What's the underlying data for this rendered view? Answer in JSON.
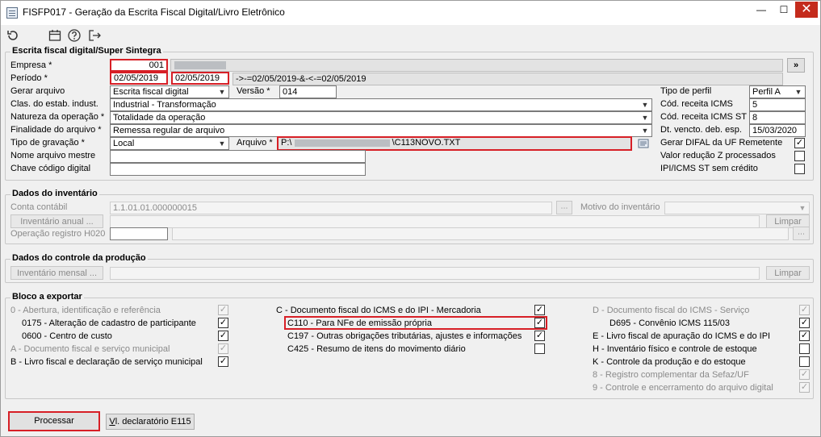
{
  "window": {
    "title": "FISFP017 - Geração da Escrita Fiscal Digital/Livro Eletrônico",
    "close_glyph": "✕"
  },
  "escrita": {
    "title": "Escrita fiscal digital/Super Sintegra",
    "empresa_label": "Empresa *",
    "empresa_value": "001",
    "periodo_label": "Período *",
    "periodo_inicio": "02/05/2019",
    "periodo_fim": "02/05/2019",
    "periodo_desc": "->-=02/05/2019-&-<-=02/05/2019",
    "gerar_label": "Gerar arquivo",
    "gerar_value": "Escrita fiscal digital",
    "versao_label": "Versão *",
    "versao_value": "014",
    "clas_label": "Clas. do estab. indust.",
    "clas_value": "Industrial - Transformação",
    "natureza_label": "Natureza da operação *",
    "natureza_value": "Totalidade da operação",
    "finalidade_label": "Finalidade do arquivo *",
    "finalidade_value": "Remessa regular de arquivo",
    "tipo_grav_label": "Tipo de gravação *",
    "tipo_grav_value": "Local",
    "arquivo_label": "Arquivo *",
    "arquivo_prefix": "P:\\",
    "arquivo_suffix": "\\C113NOVO.TXT",
    "nome_mestre_label": "Nome arquivo mestre",
    "chave_label": "Chave código digital",
    "tipo_perfil_label": "Tipo de perfil",
    "tipo_perfil_value": "Perfil A",
    "cod_icms_label": "Cód. receita ICMS",
    "cod_icms_value": "5",
    "cod_icms_st_label": "Cód. receita ICMS ST",
    "cod_icms_st_value": "8",
    "dt_vencto_label": "Dt. vencto. deb. esp.",
    "dt_vencto_value": "15/03/2020",
    "difal_label": "Gerar DIFAL da UF Remetente",
    "reducao_label": "Valor redução Z processados",
    "ipi_label": "IPI/ICMS ST sem crédito",
    "more_button": "»"
  },
  "inventario": {
    "title": "Dados do inventário",
    "conta_label": "Conta contábil",
    "conta_value": "1.1.01.01.000000015",
    "motivo_label": "Motivo do inventário",
    "anual_button": "Inventário anual ...",
    "limpar_button": "Limpar",
    "operacao_label": "Operação registro H020"
  },
  "producao": {
    "title": "Dados do controle da produção",
    "mensal_button": "Inventário mensal ...",
    "limpar_button": "Limpar"
  },
  "bloco": {
    "title": "Bloco a exportar",
    "col1": [
      "0 - Abertura, identificação e referência",
      "0175 - Alteração de cadastro de participante",
      "0600 - Centro de custo",
      "A - Documento fiscal e serviço municipal",
      "B - Livro fiscal e declaração de serviço municipal"
    ],
    "col2": [
      "C - Documento fiscal do ICMS e do IPI - Mercadoria",
      "C110 - Para NFe de emissão própria",
      "C197 - Outras obrigações tributárias, ajustes e informações",
      "C425 - Resumo de itens do movimento diário"
    ],
    "col3": [
      "D - Documento fiscal do ICMS - Serviço",
      "D695 - Convênio ICMS 115/03",
      "E - Livro fiscal de apuração do ICMS e do IPI",
      "H - Inventário físico e controle de estoque",
      "K - Controle da produção e do estoque",
      "8 - Registro complementar da Sefaz/UF",
      "9 - Controle e encerramento do arquivo digital"
    ],
    "check_glyph": "✓"
  },
  "footer": {
    "processar_button": "Processar",
    "vl_button_u": "V",
    "vl_button_rest": "l. declaratório E115"
  }
}
